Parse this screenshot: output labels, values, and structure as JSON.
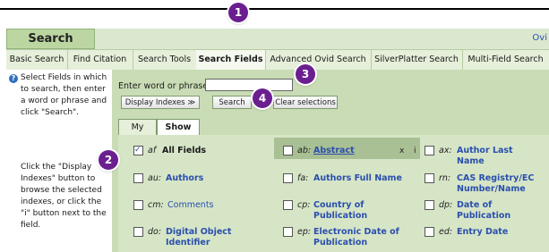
{
  "callouts": [
    "1",
    "2",
    "3",
    "4"
  ],
  "header": {
    "title": "Search",
    "right_text": "Ovi"
  },
  "nav_tabs": [
    "Basic Search",
    "Find Citation",
    "Search Tools",
    "Search Fields",
    "Advanced Ovid Search",
    "SilverPlatter Search",
    "Multi-Field Search"
  ],
  "sidebar": {
    "help_icon": "?",
    "text1": "Select Fields in which to search, then enter a word or phrase and click \"Search\".",
    "text2": "Click the \"Display Indexes\" button to browse the selected indexes, or click the \"i\" button next to the field."
  },
  "search": {
    "phrase_label": "Enter word or phrase:",
    "phrase_value": "",
    "display_indexes": "Display Indexes ≫",
    "search": "Search",
    "clear": "Clear selections"
  },
  "subtabs": [
    "My Fields",
    "Show All"
  ],
  "fields": [
    {
      "abbr": "af",
      "name": "All Fields",
      "checked": true
    },
    {
      "abbr": "ab:",
      "name": "Abstract",
      "checked": false,
      "x": "x",
      "i": "i"
    },
    {
      "abbr": "ax:",
      "name": "Author Last Name",
      "checked": false
    },
    {
      "abbr": "au:",
      "name": "Authors",
      "checked": false
    },
    {
      "abbr": "fa:",
      "name": "Authors Full Name",
      "checked": false
    },
    {
      "abbr": "rn:",
      "name": "CAS Registry/EC Number/Name",
      "checked": false
    },
    {
      "abbr": "cm:",
      "name": "Comments",
      "checked": false
    },
    {
      "abbr": "cp:",
      "name": "Country of Publication",
      "checked": false
    },
    {
      "abbr": "dp:",
      "name": "Date of Publication",
      "checked": false
    },
    {
      "abbr": "do:",
      "name": "Digital Object Identifier",
      "checked": false
    },
    {
      "abbr": "ep:",
      "name": "Electronic Date of Publication",
      "checked": false
    },
    {
      "abbr": "ed:",
      "name": "Entry Date",
      "checked": false
    }
  ]
}
